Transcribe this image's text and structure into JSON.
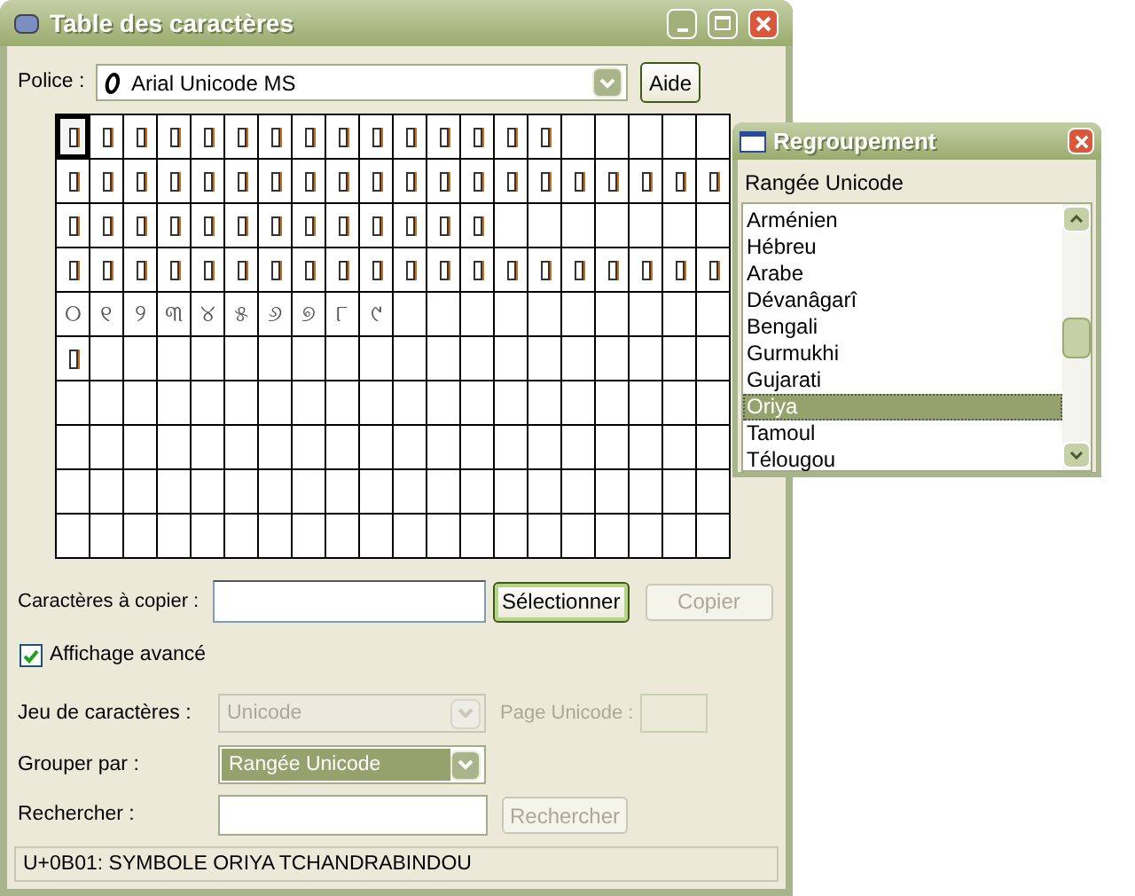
{
  "window": {
    "title": "Table des caractères"
  },
  "font": {
    "label": "Police :",
    "value": "Arial Unicode MS",
    "help_button": "Aide"
  },
  "grid": {
    "rows": [
      [
        {
          "kind": "missing",
          "selected": true
        },
        {
          "kind": "missing",
          "selected": false
        },
        {
          "kind": "missing",
          "selected": false
        },
        {
          "kind": "missing",
          "selected": false
        },
        {
          "kind": "missing",
          "selected": false
        },
        {
          "kind": "missing",
          "selected": false
        },
        {
          "kind": "missing",
          "selected": false
        },
        {
          "kind": "missing",
          "selected": false
        },
        {
          "kind": "missing",
          "selected": false
        },
        {
          "kind": "missing",
          "selected": false
        },
        {
          "kind": "missing",
          "selected": false
        },
        {
          "kind": "missing",
          "selected": false
        },
        {
          "kind": "missing",
          "selected": false
        },
        {
          "kind": "missing",
          "selected": false
        },
        {
          "kind": "missing",
          "selected": false
        }
      ],
      [
        {
          "kind": "missing",
          "selected": false
        },
        {
          "kind": "missing",
          "selected": false
        },
        {
          "kind": "missing",
          "selected": false
        },
        {
          "kind": "missing",
          "selected": false
        },
        {
          "kind": "missing",
          "selected": false
        },
        {
          "kind": "missing",
          "selected": false
        },
        {
          "kind": "missing",
          "selected": false
        },
        {
          "kind": "missing",
          "selected": false
        },
        {
          "kind": "missing",
          "selected": false
        },
        {
          "kind": "missing",
          "selected": false
        },
        {
          "kind": "missing",
          "selected": false
        },
        {
          "kind": "missing",
          "selected": false
        },
        {
          "kind": "missing",
          "selected": false
        },
        {
          "kind": "missing",
          "selected": false
        },
        {
          "kind": "missing",
          "selected": false
        },
        {
          "kind": "missing",
          "selected": false
        },
        {
          "kind": "missing",
          "selected": false
        },
        {
          "kind": "missing",
          "selected": false
        },
        {
          "kind": "missing",
          "selected": false
        },
        {
          "kind": "missing",
          "selected": false
        }
      ],
      [
        {
          "kind": "missing",
          "selected": false
        },
        {
          "kind": "missing",
          "selected": false
        },
        {
          "kind": "missing",
          "selected": false
        },
        {
          "kind": "missing",
          "selected": false
        },
        {
          "kind": "missing",
          "selected": false
        },
        {
          "kind": "missing",
          "selected": false
        },
        {
          "kind": "missing",
          "selected": false
        },
        {
          "kind": "missing",
          "selected": false
        },
        {
          "kind": "missing",
          "selected": false
        },
        {
          "kind": "missing",
          "selected": false
        },
        {
          "kind": "missing",
          "selected": false
        },
        {
          "kind": "missing",
          "selected": false
        },
        {
          "kind": "missing",
          "selected": false
        }
      ],
      [
        {
          "kind": "missing",
          "selected": false
        },
        {
          "kind": "missing",
          "selected": false
        },
        {
          "kind": "missing",
          "selected": false
        },
        {
          "kind": "missing",
          "selected": false
        },
        {
          "kind": "missing",
          "selected": false
        },
        {
          "kind": "missing",
          "selected": false
        },
        {
          "kind": "missing",
          "selected": false
        },
        {
          "kind": "missing",
          "selected": false
        },
        {
          "kind": "missing",
          "selected": false
        },
        {
          "kind": "missing",
          "selected": false
        },
        {
          "kind": "missing",
          "selected": false
        },
        {
          "kind": "missing",
          "selected": false
        },
        {
          "kind": "missing",
          "selected": false
        },
        {
          "kind": "missing",
          "selected": false
        },
        {
          "kind": "missing",
          "selected": false
        },
        {
          "kind": "missing",
          "selected": false
        },
        {
          "kind": "missing",
          "selected": false
        },
        {
          "kind": "missing",
          "selected": false
        },
        {
          "kind": "missing",
          "selected": false
        },
        {
          "kind": "missing",
          "selected": false
        }
      ],
      [
        {
          "kind": "char",
          "char": "୦",
          "selected": false
        },
        {
          "kind": "char",
          "char": "୧",
          "selected": false
        },
        {
          "kind": "char",
          "char": "୨",
          "selected": false
        },
        {
          "kind": "char",
          "char": "୩",
          "selected": false
        },
        {
          "kind": "char",
          "char": "୪",
          "selected": false
        },
        {
          "kind": "char",
          "char": "୫",
          "selected": false
        },
        {
          "kind": "char",
          "char": "୬",
          "selected": false
        },
        {
          "kind": "char",
          "char": "୭",
          "selected": false
        },
        {
          "kind": "char",
          "char": "୮",
          "selected": false
        },
        {
          "kind": "char",
          "char": "୯",
          "selected": false
        }
      ],
      [
        {
          "kind": "missing",
          "selected": false
        }
      ],
      [],
      [],
      [],
      []
    ]
  },
  "copy": {
    "label": "Caractères à copier :",
    "select_button": "Sélectionner",
    "copy_button": "Copier",
    "copy_disabled": true
  },
  "advanced": {
    "label": "Affichage avancé",
    "checked": true
  },
  "charset": {
    "label": "Jeu de caractères :",
    "value": "Unicode",
    "disabled": true,
    "page_label": "Page Unicode :"
  },
  "group_by": {
    "label": "Grouper par :",
    "value": "Rangée Unicode"
  },
  "search": {
    "label": "Rechercher :",
    "button": "Rechercher",
    "disabled": true
  },
  "status_bar": "U+0B01: SYMBOLE ORIYA TCHANDRABINDOU",
  "group_window": {
    "title": "Regroupement",
    "heading": "Rangée Unicode",
    "items": [
      {
        "label": "Arménien",
        "selected": false
      },
      {
        "label": "Hébreu",
        "selected": false
      },
      {
        "label": "Arabe",
        "selected": false
      },
      {
        "label": "Dévanâgarî",
        "selected": false
      },
      {
        "label": "Bengali",
        "selected": false
      },
      {
        "label": "Gurmukhi",
        "selected": false
      },
      {
        "label": "Gujarati",
        "selected": false
      },
      {
        "label": "Oriya",
        "selected": true
      },
      {
        "label": "Tamoul",
        "selected": false
      },
      {
        "label": "Télougou",
        "selected": false
      }
    ]
  }
}
